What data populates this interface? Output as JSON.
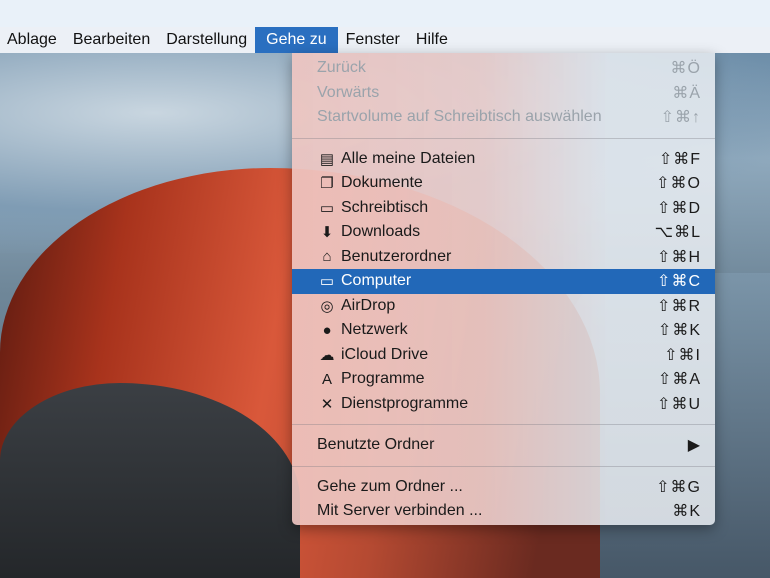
{
  "menubar": [
    "Ablage",
    "Bearbeiten",
    "Darstellung",
    "Gehe zu",
    "Fenster",
    "Hilfe"
  ],
  "menu": {
    "group1": [
      {
        "label": "Zurück",
        "shortcut": "⌘Ö"
      },
      {
        "label": "Vorwärts",
        "shortcut": "⌘Ä"
      },
      {
        "label": "Startvolume auf Schreibtisch auswählen",
        "shortcut": "⇧⌘↑"
      }
    ],
    "group2": [
      {
        "label": "Alle meine Dateien",
        "shortcut": "⇧⌘F",
        "icon": "▤"
      },
      {
        "label": "Dokumente",
        "shortcut": "⇧⌘O",
        "icon": "❐"
      },
      {
        "label": "Schreibtisch",
        "shortcut": "⇧⌘D",
        "icon": "▭"
      },
      {
        "label": "Downloads",
        "shortcut": "⌥⌘L",
        "icon": "⬇"
      },
      {
        "label": "Benutzerordner",
        "shortcut": "⇧⌘H",
        "icon": "⌂"
      },
      {
        "label": "Computer",
        "shortcut": "⇧⌘C",
        "icon": "▭"
      },
      {
        "label": "AirDrop",
        "shortcut": "⇧⌘R",
        "icon": "◎"
      },
      {
        "label": "Netzwerk",
        "shortcut": "⇧⌘K",
        "icon": "●"
      },
      {
        "label": "iCloud Drive",
        "shortcut": "⇧⌘I",
        "icon": "☁"
      },
      {
        "label": "Programme",
        "shortcut": "⇧⌘A",
        "icon": "A"
      },
      {
        "label": "Dienstprogramme",
        "shortcut": "⇧⌘U",
        "icon": "✕"
      }
    ],
    "recent": {
      "label": "Benutzte Ordner",
      "shortcut": "▶"
    },
    "group4": [
      {
        "label": "Gehe zum Ordner ...",
        "shortcut": "⇧⌘G"
      },
      {
        "label": "Mit Server verbinden ...",
        "shortcut": "⌘K"
      }
    ]
  }
}
